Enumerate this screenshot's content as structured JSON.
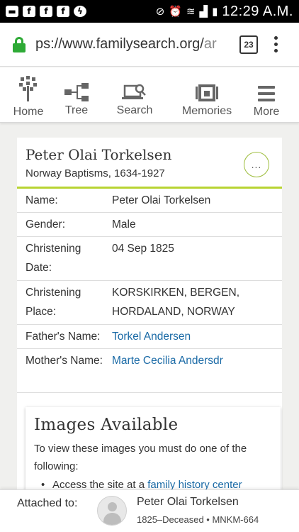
{
  "status_bar": {
    "left_icons": [
      "message-icon",
      "facebook-icon",
      "facebook-icon",
      "facebook-icon",
      "messenger-icon"
    ],
    "time": "12:29 A.M."
  },
  "browser": {
    "url_host": "ps://www.familysearch.org/",
    "url_rest": "ar",
    "tab_count": "23"
  },
  "nav": {
    "items": [
      {
        "label": "Home",
        "icon": "tree-home-icon"
      },
      {
        "label": "Tree",
        "icon": "pedigree-icon"
      },
      {
        "label": "Search",
        "icon": "search-laptop-icon"
      },
      {
        "label": "Memories",
        "icon": "photo-icon"
      },
      {
        "label": "More",
        "icon": "hamburger-icon"
      }
    ]
  },
  "record": {
    "name": "Peter Olai Torkelsen",
    "collection": "Norway Baptisms, 1634-1927",
    "more_label": "...",
    "fields": [
      {
        "label": "Name:",
        "value": "Peter Olai Torkelsen",
        "link": false
      },
      {
        "label": "Gender:",
        "value": "Male",
        "link": false
      },
      {
        "label": "Christening Date:",
        "value": "04 Sep 1825",
        "link": false
      },
      {
        "label": "Christening Place:",
        "value": "KORSKIRKEN, BERGEN, HORDALAND, NORWAY",
        "link": false
      },
      {
        "label": "Father's Name:",
        "value": "Torkel Andersen",
        "link": true
      },
      {
        "label": "Mother's Name:",
        "value": "Marte Cecilia Andersdr",
        "link": true
      }
    ]
  },
  "images": {
    "title": "Images Available",
    "text": "To view these images you must do one of the following:",
    "bullet_prefix": "Access the site at a ",
    "bullet_link": "family history center"
  },
  "attached": {
    "label": "Attached to:",
    "name": "Peter Olai Torkelsen",
    "meta": "1825–Deceased • MNKM-664"
  },
  "colors": {
    "accent_green": "#b8d432",
    "link_blue": "#1a6aa6",
    "lock_green": "#2eaa36"
  }
}
